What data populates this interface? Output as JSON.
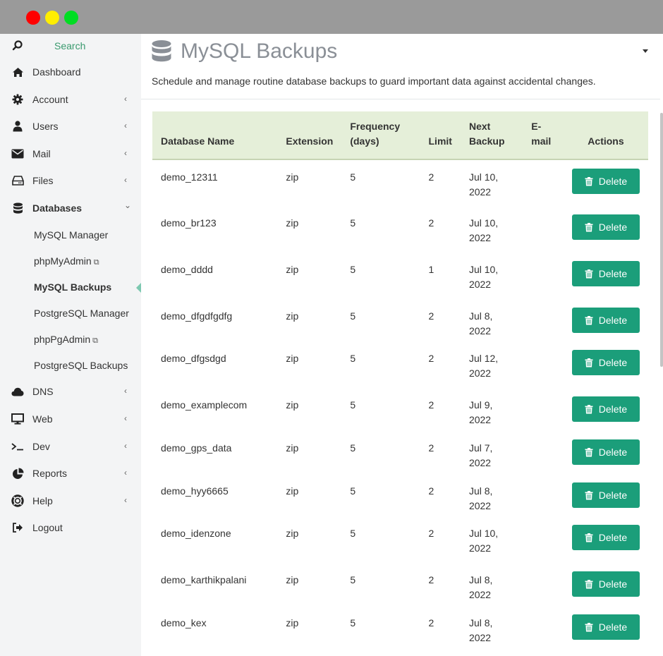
{
  "sidebar": {
    "search_label": "Search",
    "items": [
      {
        "label": "Dashboard",
        "icon": "home-icon",
        "chevron": ""
      },
      {
        "label": "Account",
        "icon": "gear-icon",
        "chevron": "‹"
      },
      {
        "label": "Users",
        "icon": "user-icon",
        "chevron": "‹"
      },
      {
        "label": "Mail",
        "icon": "envelope-icon",
        "chevron": "‹"
      },
      {
        "label": "Files",
        "icon": "hdd-icon",
        "chevron": "‹"
      },
      {
        "label": "Databases",
        "icon": "database-icon",
        "chevron": "⌄"
      },
      {
        "label": "DNS",
        "icon": "cloud-icon",
        "chevron": "‹"
      },
      {
        "label": "Web",
        "icon": "monitor-icon",
        "chevron": "‹"
      },
      {
        "label": "Dev",
        "icon": "terminal-icon",
        "chevron": "‹"
      },
      {
        "label": "Reports",
        "icon": "pie-chart-icon",
        "chevron": "‹"
      },
      {
        "label": "Help",
        "icon": "life-ring-icon",
        "chevron": "‹"
      },
      {
        "label": "Logout",
        "icon": "logout-icon",
        "chevron": ""
      }
    ],
    "sub_items": [
      {
        "label": "MySQL Manager",
        "external": false
      },
      {
        "label": "phpMyAdmin",
        "external": true
      },
      {
        "label": "MySQL Backups",
        "external": false
      },
      {
        "label": "PostgreSQL Manager",
        "external": false
      },
      {
        "label": "phpPgAdmin",
        "external": true
      },
      {
        "label": "PostgreSQL Backups",
        "external": false
      }
    ]
  },
  "header": {
    "title": "MySQL Backups",
    "description": "Schedule and manage routine database backups to guard important data against accidental changes."
  },
  "table": {
    "columns": {
      "name": "Database Name",
      "extension": "Extension",
      "frequency": "Frequency (days)",
      "limit": "Limit",
      "next": "Next Backup",
      "email": "E-mail",
      "actions": "Actions"
    },
    "delete_label": "Delete",
    "rows": [
      {
        "name": "demo_12311",
        "ext": "zip",
        "freq": "5",
        "limit": "2",
        "next": "Jul 10, 2022",
        "email": ""
      },
      {
        "name": "demo_br123",
        "ext": "zip",
        "freq": "5",
        "limit": "2",
        "next": "Jul 10, 2022",
        "email": ""
      },
      {
        "name": "demo_dddd",
        "ext": "zip",
        "freq": "5",
        "limit": "1",
        "next": "Jul 10, 2022",
        "email": ""
      },
      {
        "name": "demo_dfgdfgdfg",
        "ext": "zip",
        "freq": "5",
        "limit": "2",
        "next": "Jul 8, 2022",
        "email": ""
      },
      {
        "name": "demo_dfgsdgd",
        "ext": "zip",
        "freq": "5",
        "limit": "2",
        "next": "Jul 12, 2022",
        "email": ""
      },
      {
        "name": "demo_examplecom",
        "ext": "zip",
        "freq": "5",
        "limit": "2",
        "next": "Jul 9, 2022",
        "email": ""
      },
      {
        "name": "demo_gps_data",
        "ext": "zip",
        "freq": "5",
        "limit": "2",
        "next": "Jul 7, 2022",
        "email": ""
      },
      {
        "name": "demo_hyy6665",
        "ext": "zip",
        "freq": "5",
        "limit": "2",
        "next": "Jul 8, 2022",
        "email": ""
      },
      {
        "name": "demo_idenzone",
        "ext": "zip",
        "freq": "5",
        "limit": "2",
        "next": "Jul 10, 2022",
        "email": ""
      },
      {
        "name": "demo_karthikpalani",
        "ext": "zip",
        "freq": "5",
        "limit": "2",
        "next": "Jul 8, 2022",
        "email": ""
      },
      {
        "name": "demo_kex",
        "ext": "zip",
        "freq": "5",
        "limit": "2",
        "next": "Jul 8, 2022",
        "email": ""
      }
    ]
  },
  "colors": {
    "accent": "#1b9e7a",
    "table_header_bg": "#e5efd9",
    "search_label": "#3a9a6e"
  }
}
